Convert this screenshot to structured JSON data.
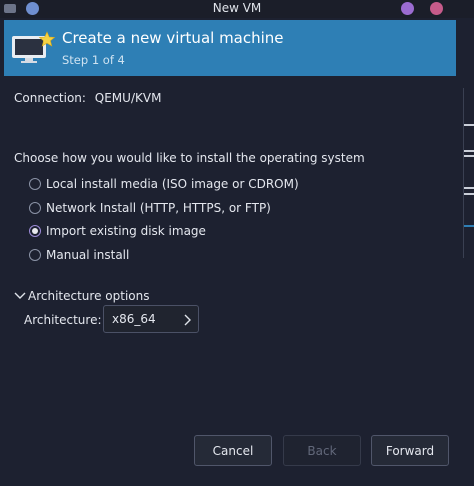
{
  "window": {
    "title": "New VM",
    "wm_dot_colors": [
      "#6f8fd0",
      "#9b6cd1",
      "#c65b8a"
    ]
  },
  "header": {
    "title": "Create a new virtual machine",
    "step": "Step 1 of 4",
    "icon": "monitor-star-icon",
    "background": "#2e7fb5"
  },
  "connection": {
    "label": "Connection:",
    "value": "QEMU/KVM"
  },
  "install": {
    "prompt": "Choose how you would like to install the operating system",
    "options": [
      {
        "label": "Local install media (ISO image or CDROM)",
        "checked": false
      },
      {
        "label": "Network Install (HTTP, HTTPS, or FTP)",
        "checked": false
      },
      {
        "label": "Import existing disk image",
        "checked": true
      },
      {
        "label": "Manual install",
        "checked": false
      }
    ]
  },
  "architecture": {
    "toggle_label": "Architecture options",
    "expanded": true,
    "field_label": "Architecture:",
    "value": "x86_64"
  },
  "buttons": {
    "cancel": "Cancel",
    "back": "Back",
    "forward": "Forward"
  }
}
